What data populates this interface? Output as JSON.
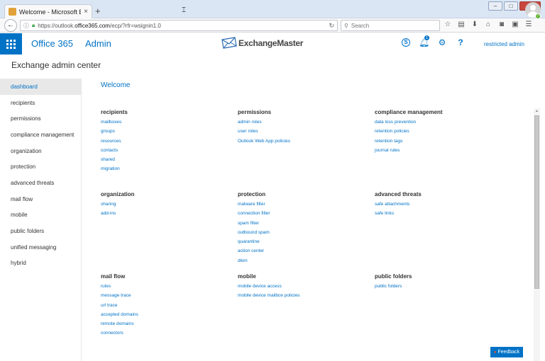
{
  "browser": {
    "tab_title": "Welcome - Microsoft Exch...",
    "tab_close": "×",
    "new_tab": "+",
    "window_buttons": [
      "–",
      "□",
      "×"
    ],
    "back_glyph": "←",
    "url_prefix": "https://outlook.",
    "url_host": "office365.com",
    "url_path": "/ecp/?rfr=wsignin1.0",
    "search_placeholder": "Search"
  },
  "suite": {
    "office_label": "Office 365",
    "admin_label": "Admin",
    "brand_name": "ExchangeMaster",
    "skype_glyph": "S",
    "notification_count": "1",
    "gear_glyph": "⚙",
    "help_glyph": "?",
    "user_name": "restricted admin"
  },
  "page_title": "Exchange admin center",
  "nav": {
    "items": [
      {
        "label": "dashboard",
        "active": true
      },
      {
        "label": "recipients"
      },
      {
        "label": "permissions"
      },
      {
        "label": "compliance management"
      },
      {
        "label": "organization"
      },
      {
        "label": "protection"
      },
      {
        "label": "advanced threats"
      },
      {
        "label": "mail flow"
      },
      {
        "label": "mobile"
      },
      {
        "label": "public folders"
      },
      {
        "label": "unified messaging"
      },
      {
        "label": "hybrid"
      }
    ]
  },
  "welcome": "Welcome",
  "sections": [
    {
      "title": "recipients",
      "links": [
        "mailboxes",
        "groups",
        "resources",
        "contacts",
        "shared",
        "migration"
      ]
    },
    {
      "title": "permissions",
      "links": [
        "admin roles",
        "user roles",
        "Outlook Web App policies"
      ]
    },
    {
      "title": "compliance management",
      "links": [
        "data loss prevention",
        "retention policies",
        "retention tags",
        "journal rules"
      ]
    },
    {
      "title": "organization",
      "links": [
        "sharing",
        "add-ins"
      ]
    },
    {
      "title": "protection",
      "links": [
        "malware filter",
        "connection filter",
        "spam filter",
        "outbound spam",
        "quarantine",
        "action center",
        "dkim"
      ]
    },
    {
      "title": "advanced threats",
      "links": [
        "safe attachments",
        "safe links"
      ]
    },
    {
      "title": "mail flow",
      "links": [
        "rules",
        "message trace",
        "url trace",
        "accepted domains",
        "remote domains",
        "connectors"
      ]
    },
    {
      "title": "mobile",
      "links": [
        "mobile device access",
        "mobile device mailbox policies"
      ]
    },
    {
      "title": "public folders",
      "links": [
        "public folders"
      ]
    }
  ],
  "feedback_label": "Feedback",
  "colors": {
    "accent": "#0072c6",
    "presence": "#5cb130"
  }
}
